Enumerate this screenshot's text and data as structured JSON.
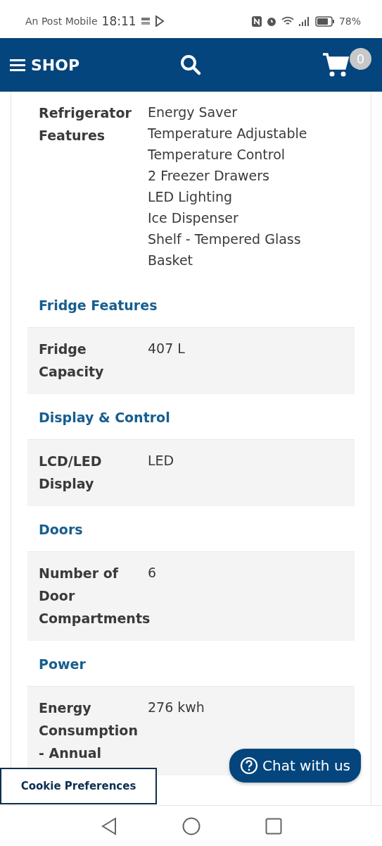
{
  "status_bar": {
    "carrier": "An Post Mobile",
    "time": "18:11",
    "battery": "78%"
  },
  "header": {
    "menu_label": "SHOP",
    "cart_count": "0"
  },
  "specs": [
    {
      "kind": "row",
      "shaded": false,
      "label_lines": [
        "Refrigerator",
        "Features"
      ],
      "values": [
        "Energy Saver",
        "Temperature Adjustable",
        "Temperature Control",
        "2 Freezer Drawers",
        "LED Lighting",
        "Ice Dispenser",
        "Shelf - Tempered Glass",
        "Basket"
      ]
    },
    {
      "kind": "heading",
      "title": "Fridge Features"
    },
    {
      "kind": "row",
      "shaded": true,
      "label_lines": [
        "Fridge",
        "Capacity"
      ],
      "values": [
        "407 L"
      ]
    },
    {
      "kind": "heading",
      "title": "Display & Control"
    },
    {
      "kind": "row",
      "shaded": true,
      "label_lines": [
        "LCD/LED",
        "Display"
      ],
      "values": [
        "LED"
      ]
    },
    {
      "kind": "heading",
      "title": "Doors"
    },
    {
      "kind": "row",
      "shaded": true,
      "label_lines": [
        "Number of",
        "Door",
        "Compartments"
      ],
      "values": [
        "6"
      ]
    },
    {
      "kind": "heading",
      "title": "Power"
    },
    {
      "kind": "row",
      "shaded": true,
      "label_lines": [
        "Energy",
        "Consumption",
        "- Annual"
      ],
      "values": [
        "276 kwh"
      ]
    }
  ],
  "chat_button": {
    "label": "Chat with us"
  },
  "cookie_button": {
    "label": "Cookie Preferences"
  }
}
